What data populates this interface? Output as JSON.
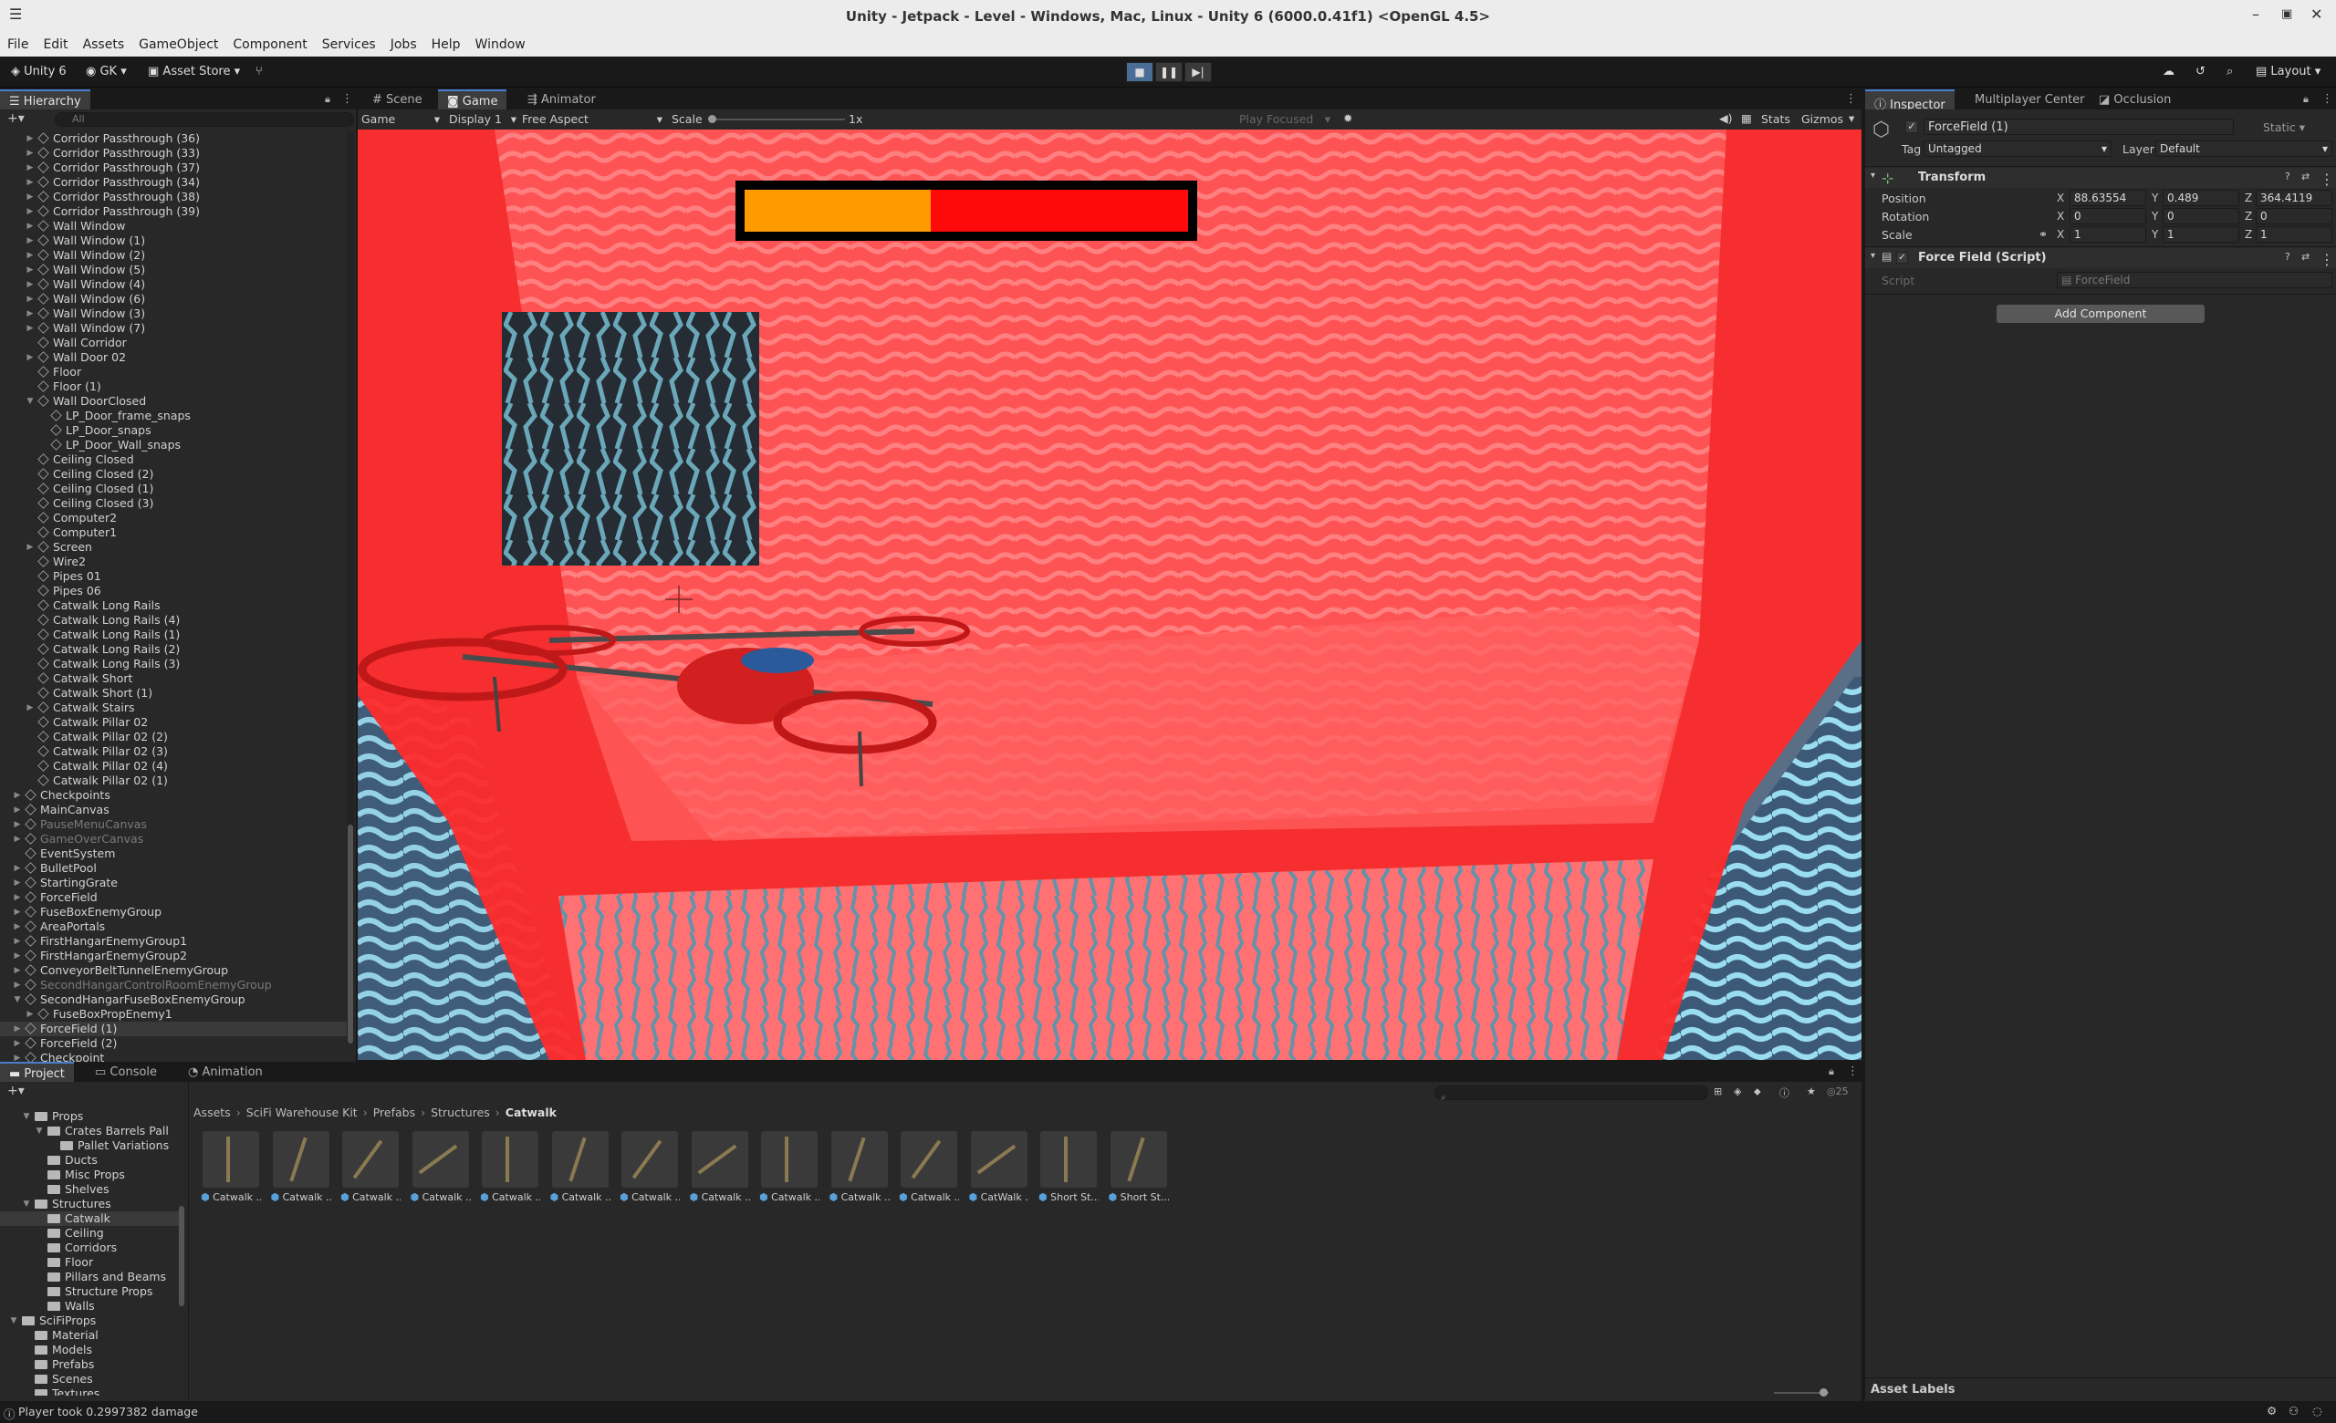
{
  "window": {
    "title": "Unity - Jetpack - Level - Windows, Mac, Linux - Unity 6 (6000.0.41f1) <OpenGL 4.5>"
  },
  "menu": [
    "File",
    "Edit",
    "Assets",
    "GameObject",
    "Component",
    "Services",
    "Jobs",
    "Help",
    "Window"
  ],
  "toolbar": {
    "unity_label": "Unity 6",
    "account": "GK",
    "asset_store": "Asset Store",
    "layout": "Layout"
  },
  "hierarchy": {
    "tab": "Hierarchy",
    "search_placeholder": "All",
    "items": [
      {
        "label": "Corridor Passthrough (36)",
        "depth": 2,
        "arrow": true
      },
      {
        "label": "Corridor Passthrough (33)",
        "depth": 2,
        "arrow": true
      },
      {
        "label": "Corridor Passthrough (37)",
        "depth": 2,
        "arrow": true
      },
      {
        "label": "Corridor Passthrough (34)",
        "depth": 2,
        "arrow": true
      },
      {
        "label": "Corridor Passthrough (38)",
        "depth": 2,
        "arrow": true
      },
      {
        "label": "Corridor Passthrough (39)",
        "depth": 2,
        "arrow": true
      },
      {
        "label": "Wall Window",
        "depth": 2,
        "arrow": true
      },
      {
        "label": "Wall Window (1)",
        "depth": 2,
        "arrow": true
      },
      {
        "label": "Wall Window (2)",
        "depth": 2,
        "arrow": true
      },
      {
        "label": "Wall Window (5)",
        "depth": 2,
        "arrow": true
      },
      {
        "label": "Wall Window (4)",
        "depth": 2,
        "arrow": true
      },
      {
        "label": "Wall Window (6)",
        "depth": 2,
        "arrow": true
      },
      {
        "label": "Wall Window (3)",
        "depth": 2,
        "arrow": true
      },
      {
        "label": "Wall Window (7)",
        "depth": 2,
        "arrow": true
      },
      {
        "label": "Wall Corridor",
        "depth": 2,
        "arrow": false
      },
      {
        "label": "Wall Door 02",
        "depth": 2,
        "arrow": true
      },
      {
        "label": "Floor",
        "depth": 2,
        "arrow": false
      },
      {
        "label": "Floor (1)",
        "depth": 2,
        "arrow": false
      },
      {
        "label": "Wall DoorClosed",
        "depth": 2,
        "arrow": true,
        "open": true
      },
      {
        "label": "LP_Door_frame_snaps",
        "depth": 3,
        "arrow": false
      },
      {
        "label": "LP_Door_snaps",
        "depth": 3,
        "arrow": false
      },
      {
        "label": "LP_Door_Wall_snaps",
        "depth": 3,
        "arrow": false
      },
      {
        "label": "Ceiling Closed",
        "depth": 2,
        "arrow": false
      },
      {
        "label": "Ceiling Closed (2)",
        "depth": 2,
        "arrow": false
      },
      {
        "label": "Ceiling Closed (1)",
        "depth": 2,
        "arrow": false
      },
      {
        "label": "Ceiling Closed (3)",
        "depth": 2,
        "arrow": false
      },
      {
        "label": "Computer2",
        "depth": 2,
        "arrow": false
      },
      {
        "label": "Computer1",
        "depth": 2,
        "arrow": false
      },
      {
        "label": "Screen",
        "depth": 2,
        "arrow": true
      },
      {
        "label": "Wire2",
        "depth": 2,
        "arrow": false
      },
      {
        "label": "Pipes 01",
        "depth": 2,
        "arrow": false
      },
      {
        "label": "Pipes 06",
        "depth": 2,
        "arrow": false
      },
      {
        "label": "Catwalk Long Rails",
        "depth": 2,
        "arrow": false
      },
      {
        "label": "Catwalk Long Rails (4)",
        "depth": 2,
        "arrow": false
      },
      {
        "label": "Catwalk Long Rails (1)",
        "depth": 2,
        "arrow": false
      },
      {
        "label": "Catwalk Long Rails (2)",
        "depth": 2,
        "arrow": false
      },
      {
        "label": "Catwalk Long Rails (3)",
        "depth": 2,
        "arrow": false
      },
      {
        "label": "Catwalk Short",
        "depth": 2,
        "arrow": false
      },
      {
        "label": "Catwalk Short (1)",
        "depth": 2,
        "arrow": false
      },
      {
        "label": "Catwalk Stairs",
        "depth": 2,
        "arrow": true
      },
      {
        "label": "Catwalk Pillar 02",
        "depth": 2,
        "arrow": false
      },
      {
        "label": "Catwalk Pillar 02 (2)",
        "depth": 2,
        "arrow": false
      },
      {
        "label": "Catwalk Pillar 02 (3)",
        "depth": 2,
        "arrow": false
      },
      {
        "label": "Catwalk Pillar 02 (4)",
        "depth": 2,
        "arrow": false
      },
      {
        "label": "Catwalk Pillar 02 (1)",
        "depth": 2,
        "arrow": false
      },
      {
        "label": "Checkpoints",
        "depth": 1,
        "arrow": true
      },
      {
        "label": "MainCanvas",
        "depth": 1,
        "arrow": true
      },
      {
        "label": "PauseMenuCanvas",
        "depth": 1,
        "arrow": true,
        "dim": true
      },
      {
        "label": "GameOverCanvas",
        "depth": 1,
        "arrow": true,
        "dim": true
      },
      {
        "label": "EventSystem",
        "depth": 1,
        "arrow": false
      },
      {
        "label": "BulletPool",
        "depth": 1,
        "arrow": true
      },
      {
        "label": "StartingGrate",
        "depth": 1,
        "arrow": true
      },
      {
        "label": "ForceField",
        "depth": 1,
        "arrow": true
      },
      {
        "label": "FuseBoxEnemyGroup",
        "depth": 1,
        "arrow": true
      },
      {
        "label": "AreaPortals",
        "depth": 1,
        "arrow": true
      },
      {
        "label": "FirstHangarEnemyGroup1",
        "depth": 1,
        "arrow": true
      },
      {
        "label": "FirstHangarEnemyGroup2",
        "depth": 1,
        "arrow": true
      },
      {
        "label": "ConveyorBeltTunnelEnemyGroup",
        "depth": 1,
        "arrow": true
      },
      {
        "label": "SecondHangarControlRoomEnemyGroup",
        "depth": 1,
        "arrow": true,
        "dim": true
      },
      {
        "label": "SecondHangarFuseBoxEnemyGroup",
        "depth": 1,
        "arrow": true,
        "open": true
      },
      {
        "label": "FuseBoxPropEnemy1",
        "depth": 2,
        "arrow": true
      },
      {
        "label": "ForceField (1)",
        "depth": 1,
        "arrow": true,
        "selected": true
      },
      {
        "label": "ForceField (2)",
        "depth": 1,
        "arrow": true
      },
      {
        "label": "Checkpoint",
        "depth": 1,
        "arrow": true
      }
    ]
  },
  "center_tabs": [
    "Scene",
    "Game",
    "Animator"
  ],
  "game_bar": {
    "mode": "Game",
    "display": "Display 1",
    "aspect": "Free Aspect",
    "scale_label": "Scale",
    "scale_value": "1x",
    "play_focused": "Play Focused",
    "stats": "Stats",
    "gizmos": "Gizmos"
  },
  "game_view": {
    "health_fraction": 0.42,
    "bar_fill_color": "#ff9a00",
    "bar_empty_color": "#ff0a0a"
  },
  "inspector": {
    "tabs": [
      "Inspector",
      "Multiplayer Center",
      "Occlusion"
    ],
    "object_name": "ForceField (1)",
    "static_label": "Static",
    "tag_label": "Tag",
    "tag_value": "Untagged",
    "layer_label": "Layer",
    "layer_value": "Default",
    "transform": {
      "title": "Transform",
      "position_label": "Position",
      "position": {
        "x": "88.63554",
        "y": "0.489",
        "z": "364.4119"
      },
      "rotation_label": "Rotation",
      "rotation": {
        "x": "0",
        "y": "0",
        "z": "0"
      },
      "scale_label": "Scale",
      "scale": {
        "x": "1",
        "y": "1",
        "z": "1"
      }
    },
    "script_component": {
      "title": "Force Field (Script)",
      "script_label": "Script",
      "script_value": "ForceField"
    },
    "add_component": "Add Component",
    "asset_labels": "Asset Labels"
  },
  "bottom_tabs": [
    "Project",
    "Console",
    "Animation"
  ],
  "project": {
    "tree": [
      {
        "label": "Props",
        "depth": 2,
        "open": true
      },
      {
        "label": "Crates Barrels Pall",
        "depth": 3,
        "open": true
      },
      {
        "label": "Pallet Variations",
        "depth": 4
      },
      {
        "label": "Ducts",
        "depth": 3
      },
      {
        "label": "Misc Props",
        "depth": 3
      },
      {
        "label": "Shelves",
        "depth": 3
      },
      {
        "label": "Structures",
        "depth": 2,
        "open": true
      },
      {
        "label": "Catwalk",
        "depth": 3,
        "selected": true
      },
      {
        "label": "Ceiling",
        "depth": 3
      },
      {
        "label": "Corridors",
        "depth": 3
      },
      {
        "label": "Floor",
        "depth": 3
      },
      {
        "label": "Pillars and Beams",
        "depth": 3
      },
      {
        "label": "Structure Props",
        "depth": 3
      },
      {
        "label": "Walls",
        "depth": 3
      },
      {
        "label": "SciFiProps",
        "depth": 1,
        "open": true
      },
      {
        "label": "Material",
        "depth": 2
      },
      {
        "label": "Models",
        "depth": 2
      },
      {
        "label": "Prefabs",
        "depth": 2
      },
      {
        "label": "Scenes",
        "depth": 2
      },
      {
        "label": "Textures",
        "depth": 2
      }
    ],
    "breadcrumb": [
      "Assets",
      "SciFi Warehouse Kit",
      "Prefabs",
      "Structures",
      "Catwalk"
    ],
    "item_count": "25",
    "assets": [
      "Catwalk ...",
      "Catwalk ...",
      "Catwalk ...",
      "Catwalk ...",
      "Catwalk ...",
      "Catwalk ...",
      "Catwalk ...",
      "Catwalk ...",
      "Catwalk ...",
      "Catwalk ...",
      "Catwalk ...",
      "CatWalk ...",
      "Short St...",
      "Short St..."
    ]
  },
  "status": {
    "message": "Player took 0.2997382 damage"
  }
}
